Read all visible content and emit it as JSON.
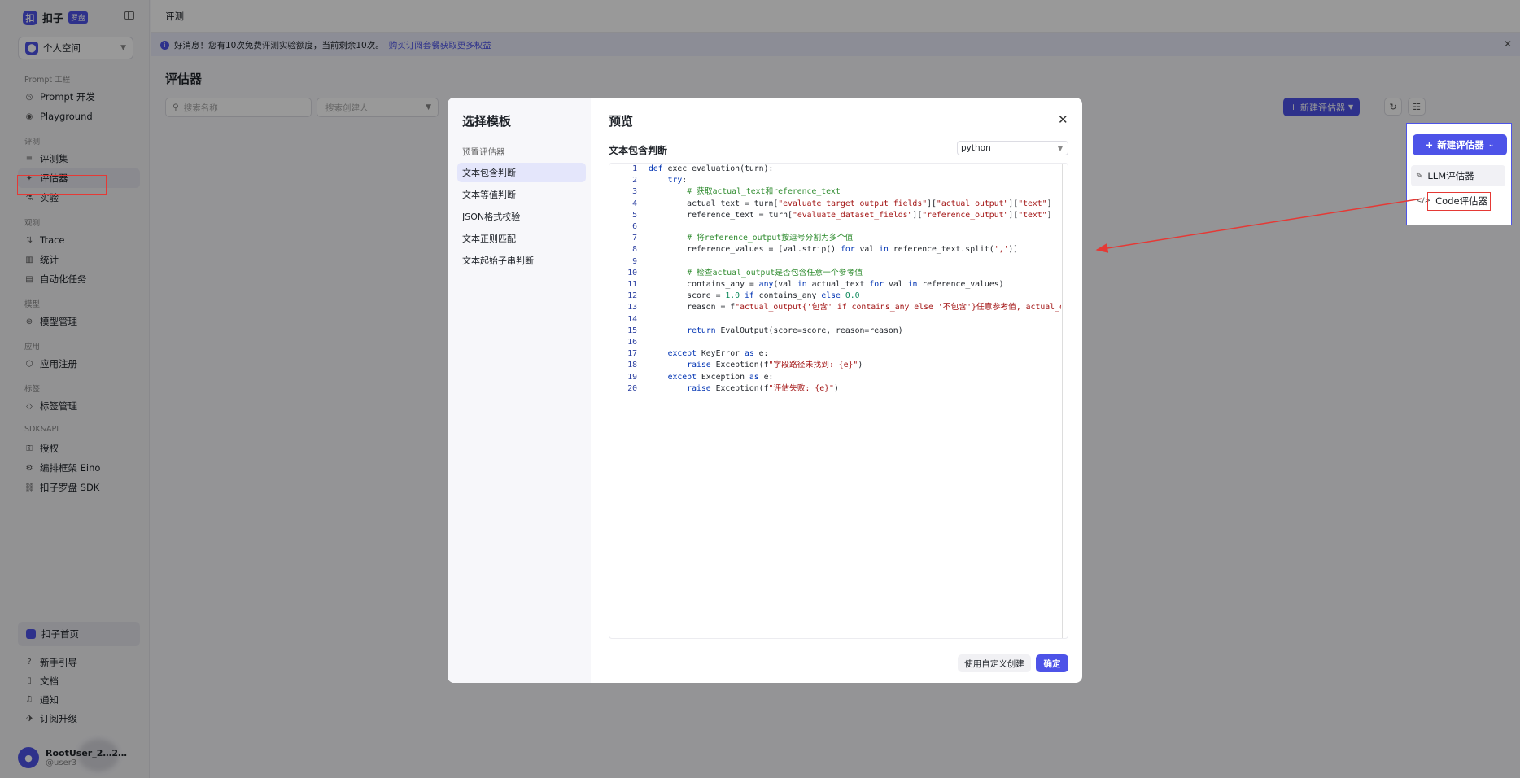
{
  "sidebar": {
    "logo_text": "扣子",
    "logo_badge": "罗盘",
    "space": "个人空间",
    "groups": [
      {
        "label": "Prompt 工程",
        "items": [
          {
            "label": "Prompt 开发",
            "icon": "◎"
          },
          {
            "label": "Playground",
            "icon": "◉"
          }
        ]
      },
      {
        "label": "评测",
        "items": [
          {
            "label": "评测集",
            "icon": "≡"
          },
          {
            "label": "评估器",
            "icon": "✦",
            "active": true
          },
          {
            "label": "实验",
            "icon": "⚗"
          }
        ]
      },
      {
        "label": "观测",
        "items": [
          {
            "label": "Trace",
            "icon": "⇅"
          },
          {
            "label": "统计",
            "icon": "▥"
          },
          {
            "label": "自动化任务",
            "icon": "▤"
          }
        ]
      },
      {
        "label": "模型",
        "items": [
          {
            "label": "模型管理",
            "icon": "⊛"
          }
        ]
      },
      {
        "label": "应用",
        "items": [
          {
            "label": "应用注册",
            "icon": "⬡"
          }
        ]
      },
      {
        "label": "标签",
        "items": [
          {
            "label": "标签管理",
            "icon": "◇"
          }
        ]
      },
      {
        "label": "SDK&API",
        "items": [
          {
            "label": "授权",
            "icon": "⚿"
          },
          {
            "label": "编排框架 Eino",
            "icon": "⚙"
          },
          {
            "label": "扣子罗盘 SDK",
            "icon": "⛓"
          }
        ]
      }
    ],
    "home": "扣子首页",
    "bottom_items": [
      {
        "label": "新手引导",
        "icon": "?"
      },
      {
        "label": "文档",
        "icon": "▯"
      },
      {
        "label": "通知",
        "icon": "♫"
      },
      {
        "label": "订阅升级",
        "icon": "⬗"
      }
    ],
    "user_name": "RootUser_2…2…",
    "user_id": "@user3"
  },
  "topbar": {
    "breadcrumb": "评测"
  },
  "notice": {
    "text": "好消息！您有10次免费评测实验额度，当前剩余10次。",
    "link": "购买订阅套餐获取更多权益"
  },
  "page": {
    "title": "评估器",
    "search_placeholder": "搜索名称",
    "creator_placeholder": "搜索创建人",
    "new_button": "新建评估器"
  },
  "modal": {
    "title": "选择模板",
    "group": "预置评估器",
    "templates": [
      "文本包含判断",
      "文本等值判断",
      "JSON格式校验",
      "文本正则匹配",
      "文本起始子串判断"
    ],
    "preview_title": "预览",
    "template_name": "文本包含判断",
    "language": "python",
    "custom_button": "使用自定义创建",
    "ok_button": "确定"
  },
  "dropdown": {
    "button": "新建评估器",
    "items": [
      {
        "label": "LLM评估器",
        "icon": "✎"
      },
      {
        "label": "Code评估器",
        "icon": "</>"
      }
    ]
  }
}
